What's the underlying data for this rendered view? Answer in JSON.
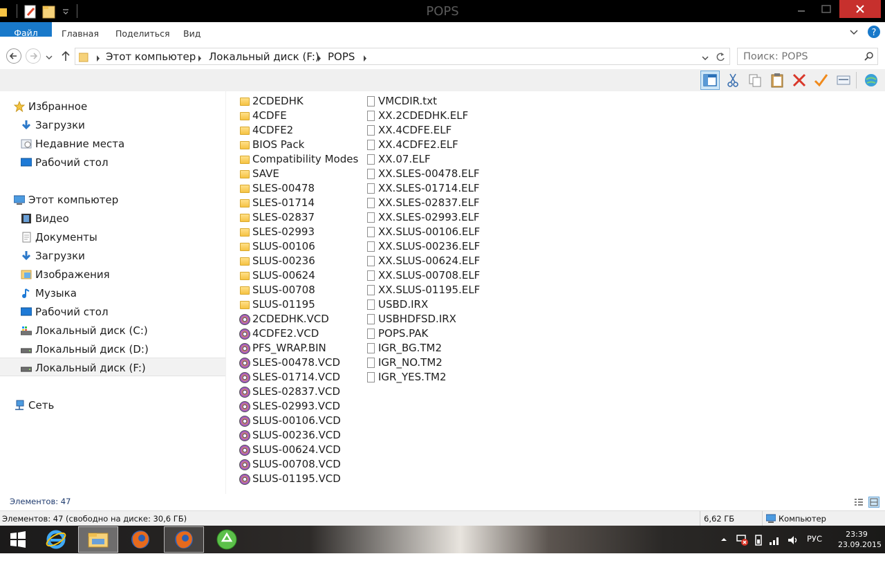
{
  "window": {
    "title": "POPS"
  },
  "ribbon": {
    "tabs": [
      "Файл",
      "Главная",
      "Поделиться",
      "Вид"
    ]
  },
  "address": {
    "crumbs": [
      "Этот компьютер",
      "Локальный диск (F:)",
      "POPS"
    ]
  },
  "search": {
    "placeholder": "Поиск: POPS"
  },
  "nav": {
    "favorites_label": "Избранное",
    "favorites": [
      "Загрузки",
      "Недавние места",
      "Рабочий стол"
    ],
    "computer_label": "Этот компьютер",
    "computer": [
      "Видео",
      "Документы",
      "Загрузки",
      "Изображения",
      "Музыка",
      "Рабочий стол",
      "Локальный диск (C:)",
      "Локальный диск (D:)",
      "Локальный диск (F:)"
    ],
    "network_label": "Сеть"
  },
  "files": {
    "column1": [
      {
        "name": "2CDEDHK",
        "type": "folder"
      },
      {
        "name": "4CDFE",
        "type": "folder"
      },
      {
        "name": "4CDFE2",
        "type": "folder"
      },
      {
        "name": "BIOS Pack",
        "type": "folder"
      },
      {
        "name": "Compatibility Modes",
        "type": "folder"
      },
      {
        "name": "SAVE",
        "type": "folder"
      },
      {
        "name": "SLES-00478",
        "type": "folder"
      },
      {
        "name": "SLES-01714",
        "type": "folder"
      },
      {
        "name": "SLES-02837",
        "type": "folder"
      },
      {
        "name": "SLES-02993",
        "type": "folder"
      },
      {
        "name": "SLUS-00106",
        "type": "folder"
      },
      {
        "name": "SLUS-00236",
        "type": "folder"
      },
      {
        "name": "SLUS-00624",
        "type": "folder"
      },
      {
        "name": "SLUS-00708",
        "type": "folder"
      },
      {
        "name": "SLUS-01195",
        "type": "folder"
      },
      {
        "name": "2CDEDHK.VCD",
        "type": "disc"
      },
      {
        "name": "4CDFE2.VCD",
        "type": "disc"
      },
      {
        "name": "PFS_WRAP.BIN",
        "type": "disc"
      },
      {
        "name": "SLES-00478.VCD",
        "type": "disc"
      },
      {
        "name": "SLES-01714.VCD",
        "type": "disc"
      },
      {
        "name": "SLES-02837.VCD",
        "type": "disc"
      },
      {
        "name": "SLES-02993.VCD",
        "type": "disc"
      },
      {
        "name": "SLUS-00106.VCD",
        "type": "disc"
      },
      {
        "name": "SLUS-00236.VCD",
        "type": "disc"
      },
      {
        "name": "SLUS-00624.VCD",
        "type": "disc"
      },
      {
        "name": "SLUS-00708.VCD",
        "type": "disc"
      },
      {
        "name": "SLUS-01195.VCD",
        "type": "disc"
      }
    ],
    "column2": [
      {
        "name": "VMCDIR.txt",
        "type": "doc"
      },
      {
        "name": "XX.2CDEDHK.ELF",
        "type": "doc"
      },
      {
        "name": "XX.4CDFE.ELF",
        "type": "doc"
      },
      {
        "name": "XX.4CDFE2.ELF",
        "type": "doc"
      },
      {
        "name": "XX.07.ELF",
        "type": "doc"
      },
      {
        "name": "XX.SLES-00478.ELF",
        "type": "doc"
      },
      {
        "name": "XX.SLES-01714.ELF",
        "type": "doc"
      },
      {
        "name": "XX.SLES-02837.ELF",
        "type": "doc"
      },
      {
        "name": "XX.SLES-02993.ELF",
        "type": "doc"
      },
      {
        "name": "XX.SLUS-00106.ELF",
        "type": "doc"
      },
      {
        "name": "XX.SLUS-00236.ELF",
        "type": "doc"
      },
      {
        "name": "XX.SLUS-00624.ELF",
        "type": "doc"
      },
      {
        "name": "XX.SLUS-00708.ELF",
        "type": "doc"
      },
      {
        "name": "XX.SLUS-01195.ELF",
        "type": "doc"
      },
      {
        "name": "USBD.IRX",
        "type": "doc"
      },
      {
        "name": "USBHDFSD.IRX",
        "type": "doc"
      },
      {
        "name": "POPS.PAK",
        "type": "doc"
      },
      {
        "name": "IGR_BG.TM2",
        "type": "doc"
      },
      {
        "name": "IGR_NO.TM2",
        "type": "doc"
      },
      {
        "name": "IGR_YES.TM2",
        "type": "doc"
      }
    ]
  },
  "status": {
    "items_count": "Элементов: 47",
    "bar_left": "Элементов: 47 (свободно на диске: 30,6 ГБ)",
    "bar_size": "6,62 ГБ",
    "bar_location": "Компьютер"
  },
  "tray": {
    "lang": "РУС",
    "time": "23:39",
    "date": "23.09.2015"
  },
  "colors": {
    "accent": "#1979ca",
    "folder": "#f6c343"
  }
}
